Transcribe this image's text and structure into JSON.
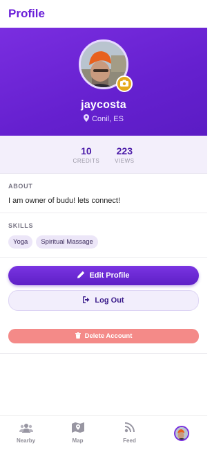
{
  "header": {
    "title": "Profile"
  },
  "profile": {
    "username": "jaycosta",
    "location": "Conil, ES",
    "stats": [
      {
        "value": "10",
        "label": "CREDITS"
      },
      {
        "value": "223",
        "label": "VIEWS"
      }
    ]
  },
  "about": {
    "heading": "ABOUT",
    "text": "I am owner of budu! lets connect!"
  },
  "skills": {
    "heading": "SKILLS",
    "items": [
      "Yoga",
      "Spiritual Massage"
    ]
  },
  "actions": {
    "edit_label": "Edit Profile",
    "logout_label": "Log Out",
    "delete_label": "Delete Account"
  },
  "nav": {
    "items": [
      {
        "label": "Nearby",
        "icon": "users-icon"
      },
      {
        "label": "Map",
        "icon": "map-icon"
      },
      {
        "label": "Feed",
        "icon": "feed-icon"
      },
      {
        "label": "",
        "icon": "profile-avatar"
      }
    ]
  },
  "colors": {
    "accent": "#6a1fd8",
    "badge": "#e6a91c",
    "danger": "#f48a88"
  }
}
